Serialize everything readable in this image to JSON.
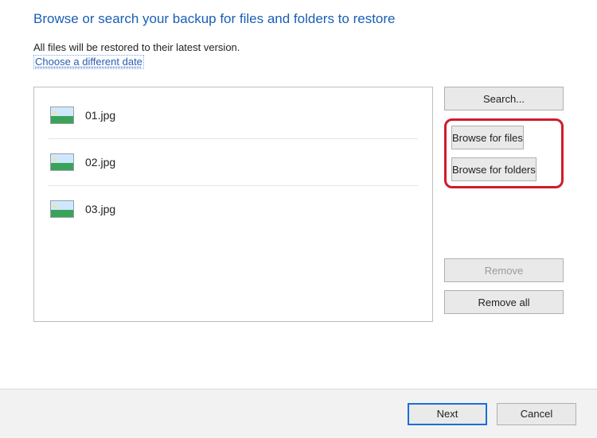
{
  "heading": "Browse or search your backup for files and folders to restore",
  "subtext": "All files will be restored to their latest version.",
  "link": "Choose a different date",
  "files": [
    {
      "name": "01.jpg"
    },
    {
      "name": "02.jpg"
    },
    {
      "name": "03.jpg"
    }
  ],
  "buttons": {
    "search": "Search...",
    "browse_files": "Browse for files",
    "browse_folders": "Browse for folders",
    "remove": "Remove",
    "remove_all": "Remove all",
    "next": "Next",
    "cancel": "Cancel"
  }
}
